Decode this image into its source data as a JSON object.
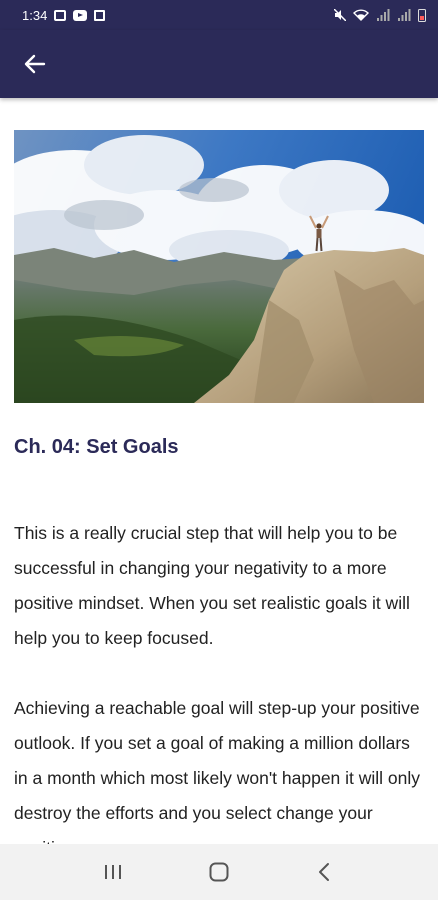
{
  "status_bar": {
    "time": "1:34",
    "left_icons": [
      "photo-icon",
      "youtube-icon",
      "square-app-icon"
    ],
    "right_icons": [
      "mute-icon",
      "wifi-icon",
      "signal-icon",
      "signal-icon",
      "battery-low-icon"
    ],
    "battery_color": "#ff5b5b"
  },
  "app_bar": {
    "back_icon": "arrow-left-icon",
    "color": "#2b2a58"
  },
  "hero_image": {
    "description_icon": "mountain-summit-photo"
  },
  "chapter": {
    "title": "Ch. 04: Set Goals",
    "paragraphs": [
      "This is a really crucial step that will help you to be successful in changing your negativity to a more positive mindset. When you set realistic goals it will help you to keep focused.",
      "Achieving a reachable goal will step-up your positive outlook. If you set a goal of making a million dollars in a month which most likely won't happen it will only destroy the efforts and you select change your positive"
    ]
  },
  "nav_bar": {
    "buttons": [
      "recent-apps-icon",
      "home-icon",
      "back-icon"
    ]
  }
}
